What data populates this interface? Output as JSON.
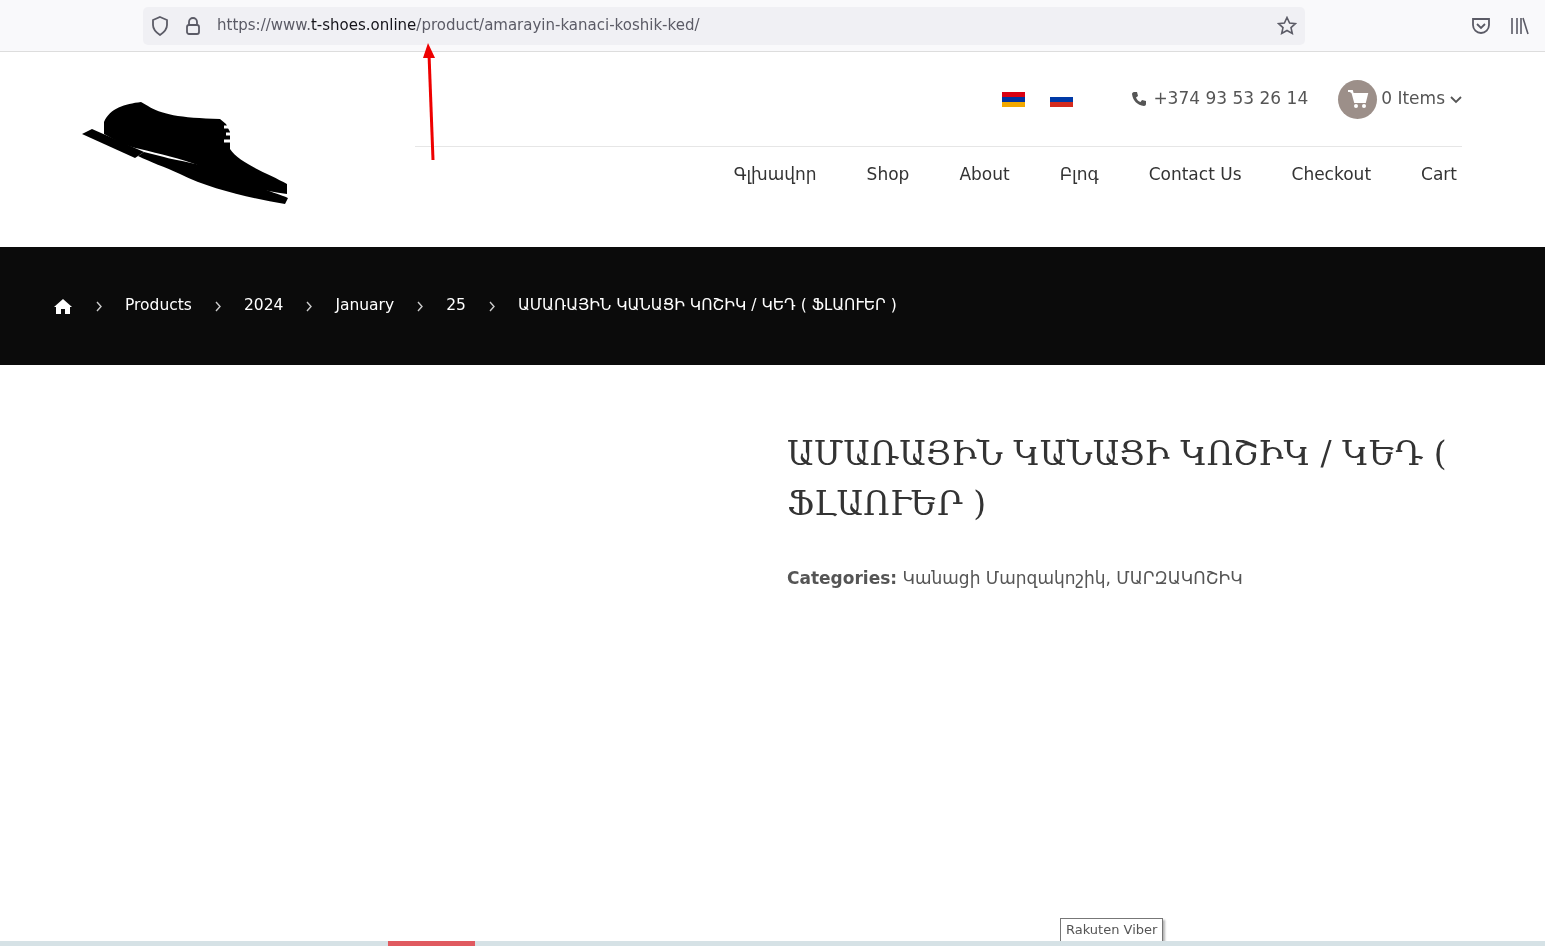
{
  "browser": {
    "url_prefix": "https://www.",
    "url_domain": "t-shoes.online",
    "url_path": "/product/amarayin-kanaci-koshik-ked/"
  },
  "header": {
    "languages": [
      {
        "kind": "armenian"
      },
      {
        "kind": "russian"
      }
    ],
    "phone": "+374 93 53 26 14",
    "cart": "0 Items",
    "nav": [
      {
        "label": "Գլխավոր"
      },
      {
        "label": "Shop"
      },
      {
        "label": "About"
      },
      {
        "label": "Բլոգ"
      },
      {
        "label": "Contact Us"
      },
      {
        "label": "Checkout"
      },
      {
        "label": "Cart"
      }
    ]
  },
  "breadcrumb": [
    "Products",
    "2024",
    "January",
    "25",
    "ԱՄԱՌԱՅԻՆ ԿԱՆԱՑԻ ԿՈՇԻԿ / ԿԵԴ ( ՖԼԱՈՒԵՐ )"
  ],
  "product": {
    "title": "ԱՄԱՌԱՅԻՆ ԿԱՆԱՑԻ ԿՈՇԻԿ / ԿԵԴ ( ՖԼԱՈՒԵՐ )",
    "categories_label": "Categories:",
    "categories": "Կանացի Մարզակոշիկ, ՄԱՐԶԱԿՈՇԻԿ"
  },
  "tooltip": "Rakuten Viber"
}
